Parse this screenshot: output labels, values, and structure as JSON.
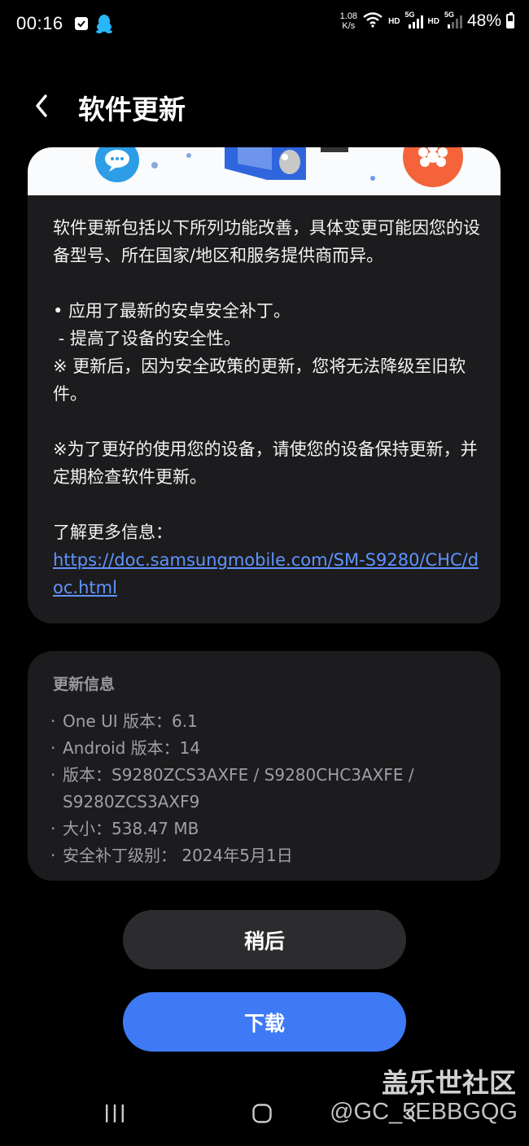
{
  "status_bar": {
    "time": "00:16",
    "net_speed_value": "1.08",
    "net_speed_unit": "K/s",
    "hd_label_1": "HD",
    "hd_label_2": "HD",
    "sig_label_1": "5G",
    "sig_label_2": "5G",
    "battery_percent": "48%",
    "battery_level": 0.48
  },
  "header": {
    "title": "软件更新"
  },
  "release_notes": {
    "paragraphs": [
      "软件更新包括以下所列功能改善，具体变更可能因您的设备型号、所在国家/地区和服务提供商而异。",
      "• 应用了最新的安卓安全补丁。",
      " - 提高了设备的安全性。",
      "※ 更新后，因为安全政策的更新，您将无法降级至旧软件。",
      "※为了更好的使用您的设备，请使您的设备保持更新，并定期检查软件更新。",
      "了解更多信息："
    ],
    "link": "https://doc.samsungmobile.com/SM-S9280/CHC/doc.html"
  },
  "update_info": {
    "title": "更新信息",
    "items": [
      "One UI 版本：6.1",
      "Android 版本：14",
      "版本：S9280ZCS3AXFE / S9280CHC3AXFE / S9280ZCS3AXF9",
      "大小：538.47 MB",
      "安全补丁级别： 2024年5月1日"
    ]
  },
  "buttons": {
    "later": "稍后",
    "download": "下载"
  },
  "watermark": {
    "site": "盖乐世社区",
    "handle": "@GC_5EBBGQG"
  },
  "colors": {
    "accent": "#3e7af5",
    "link": "#5f93ff",
    "card": "#1c1c1e",
    "secondary_button": "#2c2c2e"
  }
}
